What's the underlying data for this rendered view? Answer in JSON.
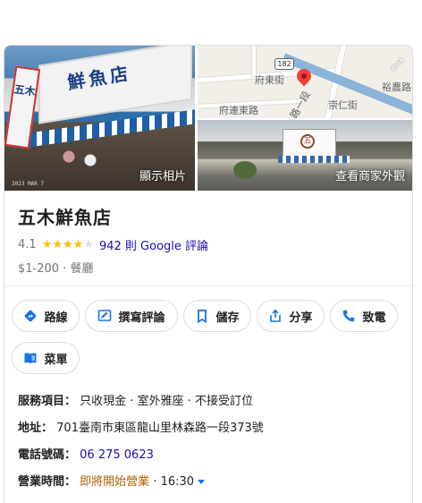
{
  "place": {
    "name": "五木鮮魚店",
    "rating": "4.1",
    "rating_value": 4.1,
    "stars_filled": 4,
    "stars_total": 5,
    "reviews_link": "942 則 Google 評論",
    "price_range": "$1-200",
    "separator": "·",
    "category": "餐廳"
  },
  "photos": {
    "main_caption": "顯示相片",
    "street_caption": "查看商家外觀",
    "stamp": "2023 MAR 7",
    "main_sign": "鮮魚店",
    "vertical_sign": "五木",
    "street_logo": "五"
  },
  "map": {
    "route_number": "182",
    "streets": [
      "府東街",
      "府連東路",
      "崇仁街",
      "裕農路",
      "路一段"
    ]
  },
  "actions": [
    {
      "label": "路線",
      "icon": "directions-icon"
    },
    {
      "label": "撰寫評論",
      "icon": "write-review-icon"
    },
    {
      "label": "儲存",
      "icon": "bookmark-icon"
    },
    {
      "label": "分享",
      "icon": "share-icon"
    },
    {
      "label": "致電",
      "icon": "phone-icon"
    },
    {
      "label": "菜單",
      "icon": "menu-book-icon"
    }
  ],
  "info": {
    "services_label": "服務項目：",
    "services_value": "只收現金 · 室外雅座 · 不接受訂位",
    "address_label": "地址：",
    "address_value": "701臺南市東區龍山里林森路一段373號",
    "phone_label": "電話號碼：",
    "phone_value": "06 275 0623",
    "hours_label": "營業時間：",
    "hours_status": "即將開始營業",
    "hours_sep": "·",
    "hours_time": "16:30"
  },
  "colors": {
    "link": "#1a0dab",
    "star": "#fbbc04",
    "icon_blue": "#1a73e8",
    "warn": "#b06000",
    "border": "#dadce0"
  }
}
